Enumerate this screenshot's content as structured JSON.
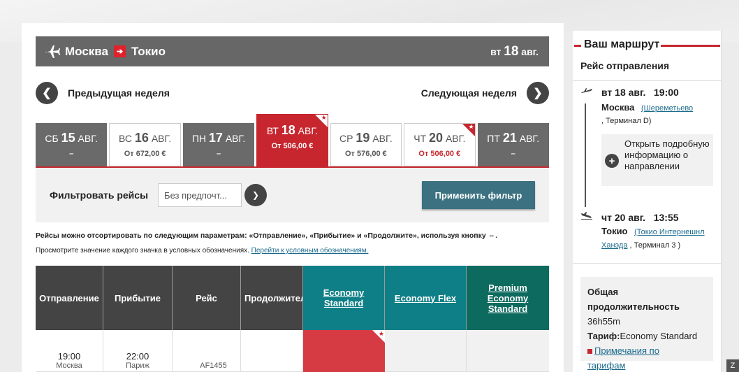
{
  "header": {
    "origin": "Москва",
    "destination": "Токио",
    "date_prefix": "вт",
    "date_num": "18",
    "date_month": "авг."
  },
  "week_nav": {
    "prev_label": "Предыдущая неделя",
    "next_label": "Следующая неделя"
  },
  "days": [
    {
      "dow": "СБ",
      "num": "15",
      "mon": "АВГ.",
      "price": "–"
    },
    {
      "dow": "ВС",
      "num": "16",
      "mon": "АВГ.",
      "price": "От 672,00 €"
    },
    {
      "dow": "ПН",
      "num": "17",
      "mon": "АВГ.",
      "price": "–"
    },
    {
      "dow": "ВТ",
      "num": "18",
      "mon": "АВГ.",
      "price": "От 506,00 €"
    },
    {
      "dow": "СР",
      "num": "19",
      "mon": "АВГ.",
      "price": "От 576,00 €"
    },
    {
      "dow": "ЧТ",
      "num": "20",
      "mon": "АВГ.",
      "price": "От 506,00 €"
    },
    {
      "dow": "ПТ",
      "num": "21",
      "mon": "АВГ.",
      "price": "–"
    }
  ],
  "filter": {
    "label": "Фильтровать рейсы",
    "select_value": "Без предпочт...",
    "apply_label": "Применить фильтр"
  },
  "notes": {
    "sort": "Рейсы можно отсортировать по следующим параметрам: «Отправление», «Прибытие» и «Продолжите», используя кнопку ⇔.",
    "legend": "Просмотрите значение каждого значка в условных обозначениях.",
    "legend_link": "Перейти к условным обозначениям."
  },
  "table": {
    "headers": {
      "departure": "Отправление",
      "arrival": "Прибытие",
      "flight": "Рейс",
      "duration": "Продолжительность",
      "eco_std_1": "Economy",
      "eco_std_2": "Standard",
      "eco_flex": "Economy Flex",
      "prem_1": "Premium",
      "prem_2": "Economy",
      "prem_3": "Standard"
    },
    "row": {
      "dep_time": "19:00",
      "dep_city": "Москва",
      "arr_time": "22:00",
      "arr_city": "Париж",
      "flight_no": "AF1455"
    }
  },
  "sidebar": {
    "title": "Ваш маршрут",
    "departure_title": "Рейс отправления",
    "dep": {
      "date": "вт 18 авг.",
      "time": "19:00",
      "city": "Москва",
      "airport": "(Шереметьево",
      "terminal": ", Терминал  D)"
    },
    "info_text": "Открыть подробную информацию о направлении",
    "arr": {
      "date": "чт 20 авг.",
      "time": "13:55",
      "city": "Токио",
      "airport_1": "(Токио Интернешнл",
      "airport_2": "Ханэда",
      "terminal": ", Терминал   3 )"
    },
    "summary": {
      "duration_label_1": "Общая",
      "duration_label_2": "продолжительность",
      "duration_value": "36h55m",
      "fare_label": "Тариф:",
      "fare_value": "Economy Standard",
      "fare_notes_1": "Примечания по",
      "fare_notes_2": "тарифам"
    }
  },
  "colors": {
    "accent_red": "#c7262e",
    "header_grey": "#676767",
    "teal": "#0f7f87",
    "apply_btn": "#3b7180"
  }
}
